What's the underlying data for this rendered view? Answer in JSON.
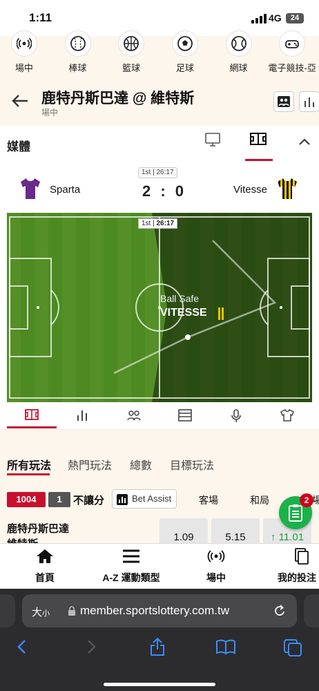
{
  "status_bar": {
    "time": "1:11",
    "network": "4G",
    "battery": "24"
  },
  "sports_nav": [
    {
      "label": "場中",
      "icon": "live-icon"
    },
    {
      "label": "棒球",
      "icon": "baseball-icon"
    },
    {
      "label": "籃球",
      "icon": "basketball-icon"
    },
    {
      "label": "足球",
      "icon": "soccer-icon"
    },
    {
      "label": "網球",
      "icon": "tennis-icon"
    },
    {
      "label": "電子競技-亞",
      "icon": "gamepad-icon"
    }
  ],
  "header": {
    "title": "鹿特丹斯巴達 @ 維特斯",
    "subtitle": "場中"
  },
  "media": {
    "label": "媒體"
  },
  "scoreboard": {
    "period": "1st | 26:17",
    "home_team": "Sparta",
    "away_team": "Vitesse",
    "score": "2 : 0"
  },
  "field": {
    "period": "1st",
    "clock": "26:17",
    "status": "Ball Safe",
    "team": "VITESSE"
  },
  "field_tabs": [
    "field-icon",
    "stats-icon",
    "lineup-icon",
    "table-icon",
    "commentary-icon",
    "shirt-icon"
  ],
  "bet_tabs": [
    {
      "label": "所有玩法",
      "active": true
    },
    {
      "label": "熱門玩法",
      "active": false
    },
    {
      "label": "總數",
      "active": false
    },
    {
      "label": "目標玩法",
      "active": false
    }
  ],
  "market": {
    "id": "1004",
    "count": "1",
    "name": "不讓分",
    "bet_assist": "Bet Assist",
    "col_away": "客場",
    "col_draw": "和局",
    "col_home_partial": "場"
  },
  "odds": {
    "team1": "鹿特丹斯巴達",
    "team2": "維特斯",
    "values": [
      "1.09",
      "5.15",
      "11.01"
    ],
    "third_trend": "up"
  },
  "fab": {
    "badge": "2"
  },
  "bottom_nav": [
    {
      "label": "首頁",
      "icon": "home-icon"
    },
    {
      "label": "A-Z 運動類型",
      "icon": "menu-icon"
    },
    {
      "label": "場中",
      "icon": "live-icon"
    },
    {
      "label": "我的投注",
      "icon": "mybets-icon"
    }
  ],
  "browser": {
    "text_size": "大",
    "text_size_small": "小",
    "url": "member.sportslottery.com.tw"
  },
  "colors": {
    "accent": "#c8102e",
    "badge_red": "#d0021b",
    "fab_green": "#1bb24a",
    "up_green": "#1a9e3c",
    "pitch": "#4d8a22"
  }
}
